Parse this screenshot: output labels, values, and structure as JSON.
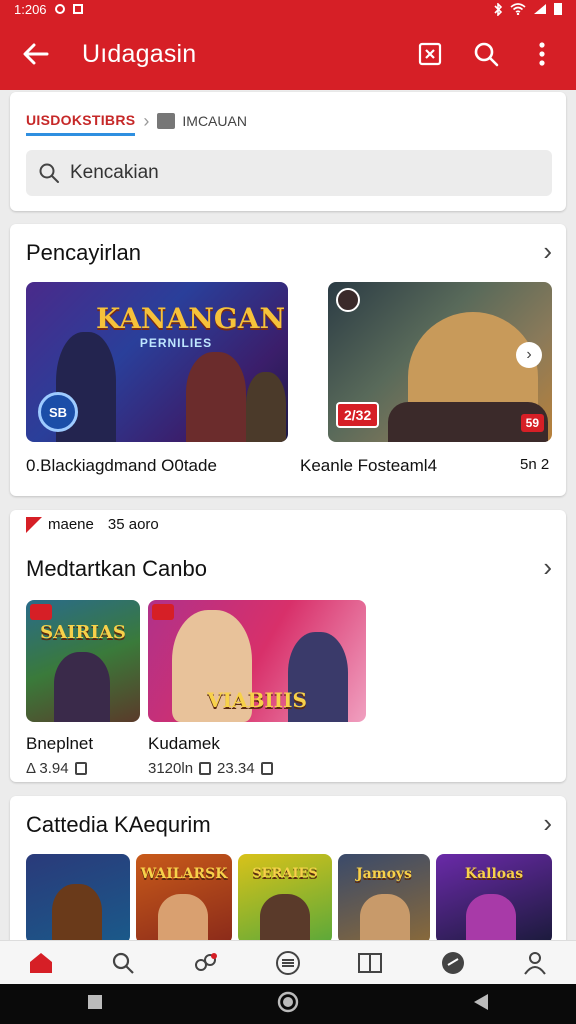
{
  "status": {
    "time": "1:206"
  },
  "appbar": {
    "title": "Uıdagasin"
  },
  "search": {
    "breadcrumb_active": "UISDOKSTIBRS",
    "breadcrumb_second": "IMCAUAN",
    "placeholder": "Kencakian"
  },
  "featured": {
    "title": "Pencayirlan",
    "banners": [
      {
        "art_title": "KANANGAN",
        "art_sub": "PERNILIES",
        "badge": "SB",
        "label": "0.Blackiagdmand O0tade"
      },
      {
        "badge": "2/32",
        "rating": "59",
        "label": "Keanle Fosteaml4",
        "extra": "5n 2"
      }
    ]
  },
  "promo": {
    "text1": "maene",
    "text2": "35 aoro"
  },
  "recommended": {
    "title": "Medtartkan Canbo",
    "items": [
      {
        "art_title": "SAIRIAS",
        "name": "Bneplnet",
        "meta": "Δ 3.94"
      },
      {
        "art_title": "VIABIIIS",
        "name": "Kudamek",
        "meta": "3120ln",
        "meta2": "23.34"
      }
    ]
  },
  "category": {
    "title": "Cattedia KAequrim",
    "tiles": [
      {
        "art_title": ""
      },
      {
        "art_title": "WAILARSK"
      },
      {
        "art_title": "SERAIES"
      },
      {
        "art_title": "Jamoys"
      },
      {
        "art_title": "Kalloas"
      }
    ]
  },
  "colors": {
    "brand": "#d61f26",
    "accent_underline": "#2f8fe0"
  }
}
